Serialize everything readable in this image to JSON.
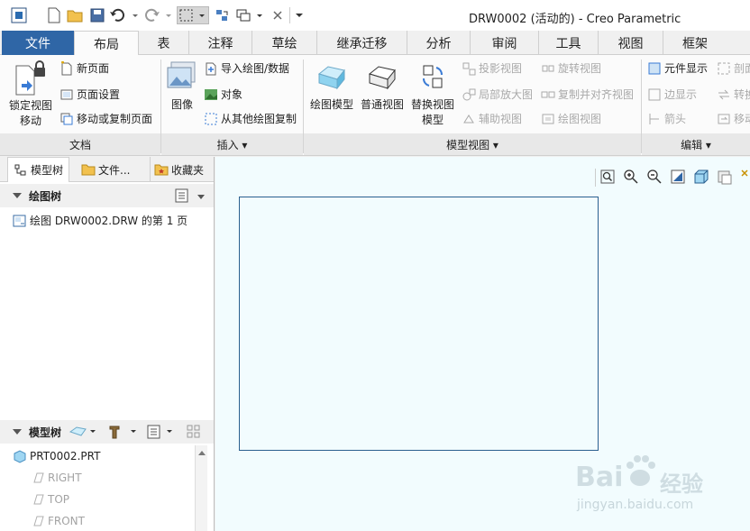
{
  "title": "DRW0002 (活动的) - Creo Parametric",
  "tabs": [
    "文件",
    "布局",
    "表",
    "注释",
    "草绘",
    "继承迁移",
    "分析",
    "审阅",
    "工具",
    "视图",
    "框架"
  ],
  "active_tab": "布局",
  "groups": {
    "doc": {
      "title": "文档",
      "lock_line1": "锁定视图",
      "lock_line2": "移动",
      "new_page": "新页面",
      "page_setup": "页面设置",
      "move_copy": "移动或复制页面"
    },
    "insert": {
      "title": "插入 ▾",
      "image": "图像",
      "import": "导入绘图/数据",
      "object": "对象",
      "copy_from": "从其他绘图复制"
    },
    "model_views": {
      "title": "模型视图 ▾",
      "drawing_model": "绘图模型",
      "general_view": "普通视图",
      "replace_line1": "替换视图",
      "replace_line2": "模型",
      "projection": "投影视图",
      "detail": "局部放大图",
      "auxiliary": "辅助视图",
      "revolve": "旋转视图",
      "copy_align": "复制并对齐视图",
      "drawing_view": "绘图视图"
    },
    "edit": {
      "title": "编辑 ▾",
      "element_display": "元件显示",
      "edge_display": "边显示",
      "arrow": "箭头",
      "cut1": "剖面",
      "cut2": "转换",
      "cut3": "移动"
    }
  },
  "left_panel": {
    "tabs": [
      "模型树",
      "文件...",
      "收藏夹"
    ],
    "drawing_tree_title": "绘图树",
    "drawing_tree_item": "绘图 DRW0002.DRW 的第 1 页",
    "model_tree_title": "模型树",
    "model_items": [
      "PRT0002.PRT",
      "RIGHT",
      "TOP",
      "FRONT"
    ]
  },
  "watermark": {
    "brand": "Bai",
    "brand2": "经验",
    "url": "jingyan.baidu.com"
  },
  "colors": {
    "file_tab": "#2f66a6",
    "frame": "#2b5f8f",
    "canvas": "#f2fcfe"
  }
}
